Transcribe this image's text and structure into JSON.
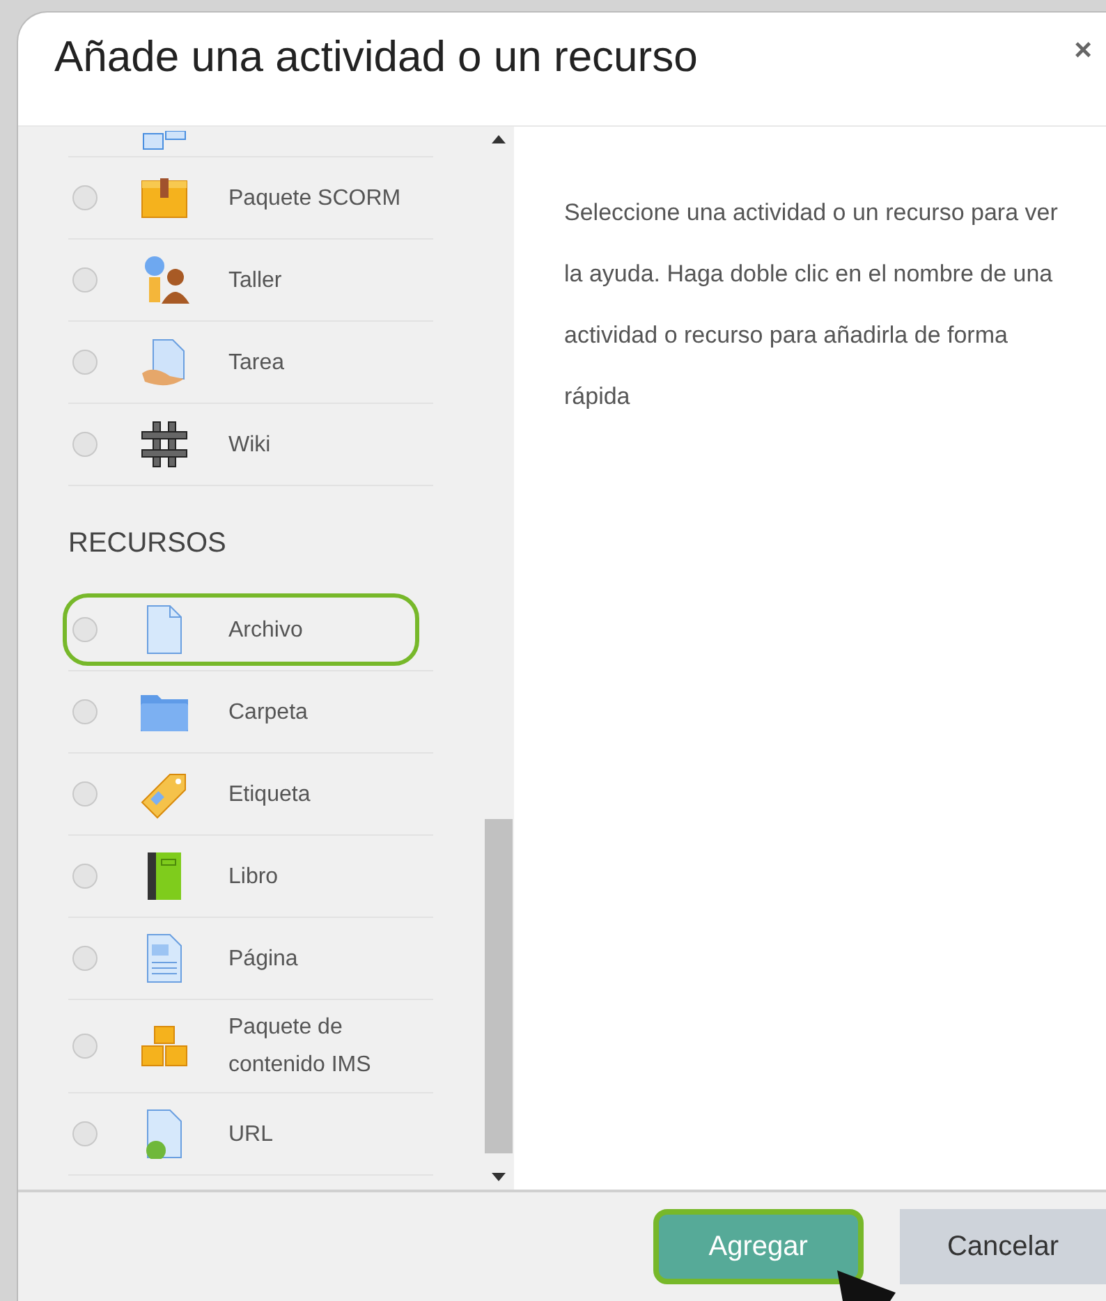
{
  "dialog": {
    "title": "Añade una actividad o un recurso",
    "close": "×"
  },
  "activities": [
    {
      "kind": "database"
    },
    {
      "kind": "scorm",
      "label": "Paquete SCORM",
      "selected": false,
      "highlighted": false
    },
    {
      "kind": "workshop",
      "label": "Taller",
      "selected": false,
      "highlighted": false
    },
    {
      "kind": "assignment",
      "label": "Tarea",
      "selected": false,
      "highlighted": false
    },
    {
      "kind": "wiki",
      "label": "Wiki",
      "selected": false,
      "highlighted": false
    }
  ],
  "resources_heading": "RECURSOS",
  "resources": [
    {
      "kind": "file",
      "label": "Archivo",
      "selected": false,
      "highlighted": true
    },
    {
      "kind": "folder",
      "label": "Carpeta",
      "selected": false,
      "highlighted": false
    },
    {
      "kind": "tag",
      "label": "Etiqueta",
      "selected": false,
      "highlighted": false
    },
    {
      "kind": "book",
      "label": "Libro",
      "selected": false,
      "highlighted": false
    },
    {
      "kind": "page",
      "label": "Página",
      "selected": false,
      "highlighted": false
    },
    {
      "kind": "ims",
      "label": "Paquete de contenido IMS",
      "selected": false,
      "highlighted": false
    },
    {
      "kind": "url",
      "label": "URL",
      "selected": false,
      "highlighted": false
    }
  ],
  "help_text": "Seleccione una actividad o un recurso para ver la ayuda. Haga doble clic en el nombre de una actividad o recurso para añadirla de forma rápida",
  "buttons": [
    {
      "kind": "primary",
      "label": "Agregar",
      "highlighted": true
    },
    {
      "kind": "secondary",
      "label": "Cancelar",
      "highlighted": false
    }
  ]
}
